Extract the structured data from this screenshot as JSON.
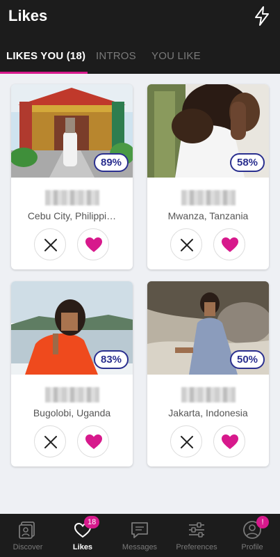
{
  "header": {
    "title": "Likes",
    "boost_icon": "lightning-bolt-icon"
  },
  "tabs": [
    {
      "label": "LIKES YOU (18)",
      "active": true
    },
    {
      "label": "INTROS",
      "active": false
    },
    {
      "label": "YOU LIKE",
      "active": false
    }
  ],
  "cards": [
    {
      "match": "89%",
      "location": "Cebu City, Philippi…"
    },
    {
      "match": "58%",
      "location": "Mwanza, Tanzania"
    },
    {
      "match": "83%",
      "location": "Bugolobi, Uganda"
    },
    {
      "match": "50%",
      "location": "Jakarta, Indonesia"
    }
  ],
  "actions": {
    "pass_icon": "close-icon",
    "like_icon": "heart-icon"
  },
  "bottom_nav": [
    {
      "label": "Discover",
      "icon": "discover-icon",
      "active": false,
      "badge": ""
    },
    {
      "label": "Likes",
      "icon": "heart-outline-icon",
      "active": true,
      "badge": "18"
    },
    {
      "label": "Messages",
      "icon": "message-icon",
      "active": false,
      "badge": ""
    },
    {
      "label": "Preferences",
      "icon": "sliders-icon",
      "active": false,
      "badge": ""
    },
    {
      "label": "Profile",
      "icon": "profile-icon",
      "active": false,
      "badge": "!"
    }
  ],
  "colors": {
    "accent": "#d7198c",
    "badge_border": "#2a2f8f",
    "header_bg": "#1c1c1c",
    "page_bg": "#eef0f4"
  }
}
